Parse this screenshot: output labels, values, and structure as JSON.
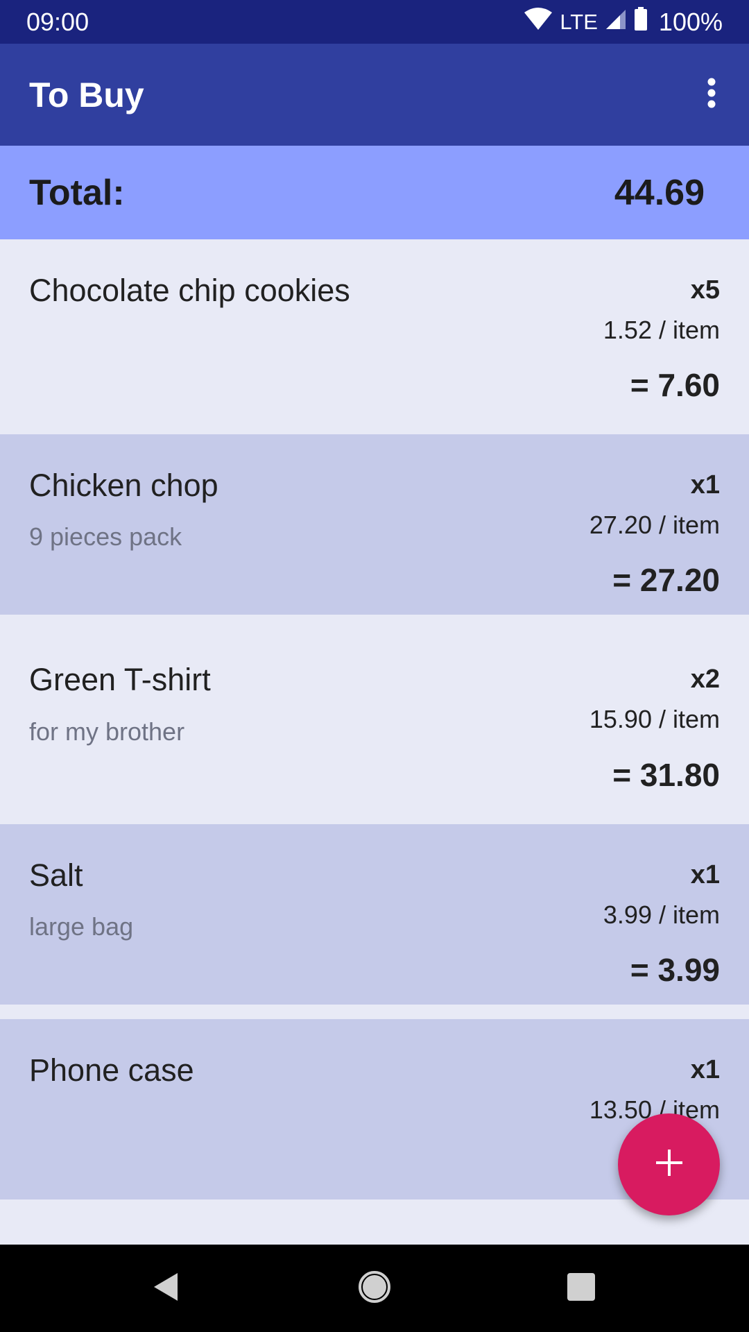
{
  "status_bar": {
    "time": "09:00",
    "network": "LTE",
    "battery": "100%"
  },
  "app_bar": {
    "title": "To Buy"
  },
  "summary": {
    "label": "Total:",
    "amount": "44.69"
  },
  "items": [
    {
      "name": "Chocolate chip cookies",
      "note": "",
      "qty": "x5",
      "unit_price": "1.52 / item",
      "subtotal": "= 7.60"
    },
    {
      "name": "Chicken chop",
      "note": "9 pieces pack",
      "qty": "x1",
      "unit_price": "27.20 / item",
      "subtotal": "= 27.20"
    },
    {
      "name": "Green T-shirt",
      "note": "for my brother",
      "qty": "x2",
      "unit_price": "15.90 / item",
      "subtotal": "= 31.80"
    },
    {
      "name": "Salt",
      "note": "large bag",
      "qty": "x1",
      "unit_price": "3.99 / item",
      "subtotal": "= 3.99"
    },
    {
      "name": "Phone case",
      "note": "",
      "qty": "x1",
      "unit_price": "13.50 / item",
      "subtotal": "="
    }
  ],
  "colors": {
    "status_bar": "#1a237e",
    "app_bar": "#303f9f",
    "total_bar": "#8c9eff",
    "row_light": "#e8eaf6",
    "row_dark": "#c5cae9",
    "fab": "#d81b60"
  },
  "icons": {
    "overflow": "more-vert-icon",
    "fab": "plus-icon",
    "nav_back": "back-triangle-icon",
    "nav_home": "home-circle-icon",
    "nav_recents": "recents-square-icon"
  }
}
